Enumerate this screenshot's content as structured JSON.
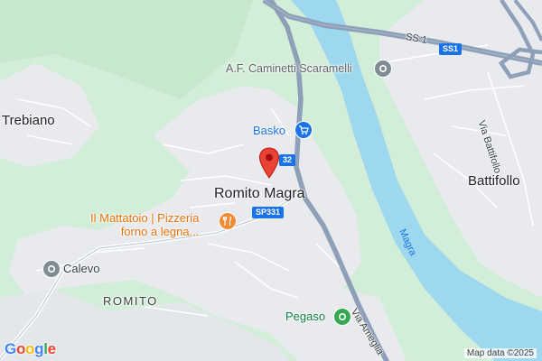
{
  "map": {
    "places": {
      "trebiano": "Trebiano",
      "romito_magra": "Romito Magra",
      "battifollo": "Battifollo",
      "calevo": "Calevo",
      "romito": "ROMITO"
    },
    "pois": {
      "caminetti": "A.F. Caminetti Scaramelli",
      "basko": "Basko",
      "mattatoio_line1": "Il Mattatoio | Pizzeria",
      "mattatoio_line2": "forno a legna...",
      "pegaso": "Pegaso"
    },
    "roads": {
      "ss1_label": "SS 1",
      "ss1_shield": "SS1",
      "sp331_shield": "SP331",
      "sp332_shield": "32",
      "via_battifollo": "Via Battifollo",
      "via_ameglia": "Via Ameglia"
    },
    "water": {
      "river_name": "Magra"
    },
    "attribution": "Map data ©2025",
    "logo": {
      "letters": [
        "G",
        "o",
        "o",
        "g",
        "l",
        "e"
      ],
      "colors": [
        "#4285F4",
        "#EA4335",
        "#FBBC05",
        "#4285F4",
        "#34A853",
        "#EA4335"
      ]
    },
    "colors": {
      "forest": "#cdebd2",
      "urban": "#e8eaed",
      "river": "#9ed8ee",
      "highway": "#8e9fb8",
      "pin": "#ea4335",
      "shop_icon": "#1a73e8",
      "food_icon": "#f28b35",
      "park_icon": "#34a853",
      "generic_icon": "#7f8c94"
    },
    "icons": {
      "pin": "location-pin-icon",
      "caminetti": "generic-place-icon",
      "basko": "shopping-cart-icon",
      "mattatoio": "fork-knife-icon",
      "calevo": "generic-place-icon",
      "pegaso": "leaf-place-icon"
    }
  }
}
